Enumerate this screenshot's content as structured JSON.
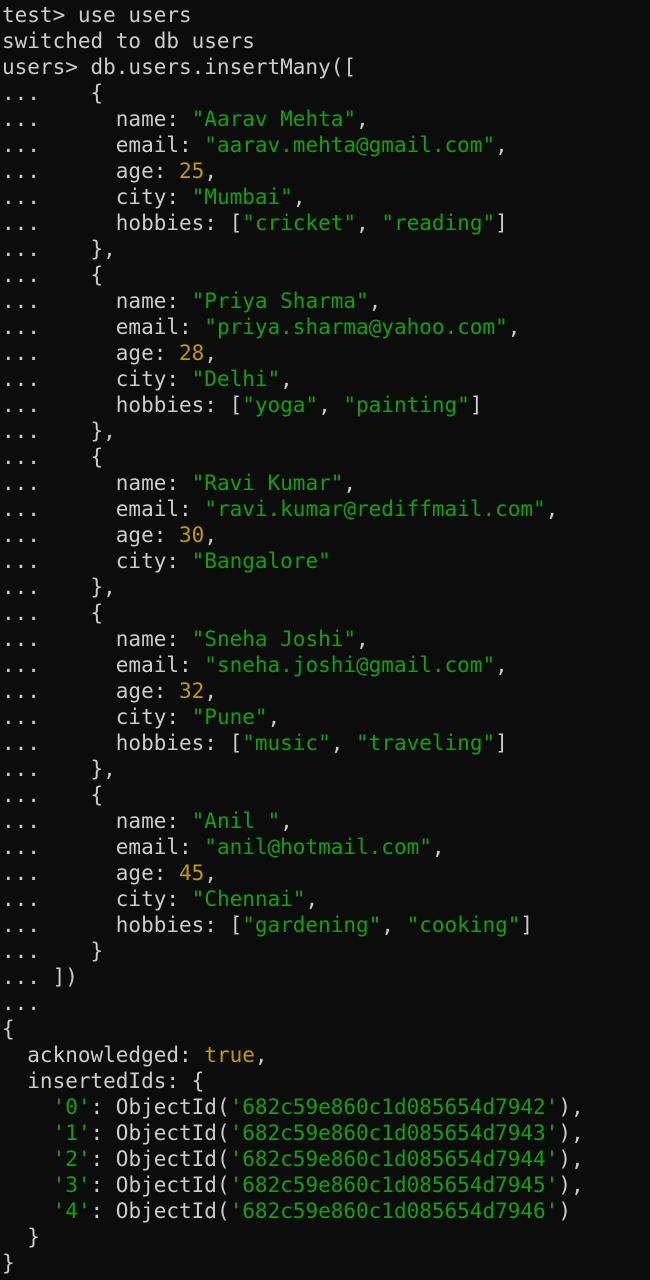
{
  "terminal": {
    "lines": [
      [
        {
          "t": "plain",
          "v": "test> use users"
        }
      ],
      [
        {
          "t": "plain",
          "v": "switched to db users"
        }
      ],
      [
        {
          "t": "plain",
          "v": "users> db.users.insertMany(["
        }
      ],
      [
        {
          "t": "plain",
          "v": "...    {"
        }
      ],
      [
        {
          "t": "plain",
          "v": "...      name: "
        },
        {
          "t": "str",
          "v": "\"Aarav Mehta\""
        },
        {
          "t": "plain",
          "v": ","
        }
      ],
      [
        {
          "t": "plain",
          "v": "...      email: "
        },
        {
          "t": "str",
          "v": "\"aarav.mehta@gmail.com\""
        },
        {
          "t": "plain",
          "v": ","
        }
      ],
      [
        {
          "t": "plain",
          "v": "...      age: "
        },
        {
          "t": "num",
          "v": "25"
        },
        {
          "t": "plain",
          "v": ","
        }
      ],
      [
        {
          "t": "plain",
          "v": "...      city: "
        },
        {
          "t": "str",
          "v": "\"Mumbai\""
        },
        {
          "t": "plain",
          "v": ","
        }
      ],
      [
        {
          "t": "plain",
          "v": "...      hobbies: ["
        },
        {
          "t": "str",
          "v": "\"cricket\""
        },
        {
          "t": "plain",
          "v": ", "
        },
        {
          "t": "str",
          "v": "\"reading\""
        },
        {
          "t": "plain",
          "v": "]"
        }
      ],
      [
        {
          "t": "plain",
          "v": "...    },"
        }
      ],
      [
        {
          "t": "plain",
          "v": "...    {"
        }
      ],
      [
        {
          "t": "plain",
          "v": "...      name: "
        },
        {
          "t": "str",
          "v": "\"Priya Sharma\""
        },
        {
          "t": "plain",
          "v": ","
        }
      ],
      [
        {
          "t": "plain",
          "v": "...      email: "
        },
        {
          "t": "str",
          "v": "\"priya.sharma@yahoo.com\""
        },
        {
          "t": "plain",
          "v": ","
        }
      ],
      [
        {
          "t": "plain",
          "v": "...      age: "
        },
        {
          "t": "num",
          "v": "28"
        },
        {
          "t": "plain",
          "v": ","
        }
      ],
      [
        {
          "t": "plain",
          "v": "...      city: "
        },
        {
          "t": "str",
          "v": "\"Delhi\""
        },
        {
          "t": "plain",
          "v": ","
        }
      ],
      [
        {
          "t": "plain",
          "v": "...      hobbies: ["
        },
        {
          "t": "str",
          "v": "\"yoga\""
        },
        {
          "t": "plain",
          "v": ", "
        },
        {
          "t": "str",
          "v": "\"painting\""
        },
        {
          "t": "plain",
          "v": "]"
        }
      ],
      [
        {
          "t": "plain",
          "v": "...    },"
        }
      ],
      [
        {
          "t": "plain",
          "v": "...    {"
        }
      ],
      [
        {
          "t": "plain",
          "v": "...      name: "
        },
        {
          "t": "str",
          "v": "\"Ravi Kumar\""
        },
        {
          "t": "plain",
          "v": ","
        }
      ],
      [
        {
          "t": "plain",
          "v": "...      email: "
        },
        {
          "t": "str",
          "v": "\"ravi.kumar@rediffmail.com\""
        },
        {
          "t": "plain",
          "v": ","
        }
      ],
      [
        {
          "t": "plain",
          "v": "...      age: "
        },
        {
          "t": "num",
          "v": "30"
        },
        {
          "t": "plain",
          "v": ","
        }
      ],
      [
        {
          "t": "plain",
          "v": "...      city: "
        },
        {
          "t": "str",
          "v": "\"Bangalore\""
        }
      ],
      [
        {
          "t": "plain",
          "v": "...    },"
        }
      ],
      [
        {
          "t": "plain",
          "v": "...    {"
        }
      ],
      [
        {
          "t": "plain",
          "v": "...      name: "
        },
        {
          "t": "str",
          "v": "\"Sneha Joshi\""
        },
        {
          "t": "plain",
          "v": ","
        }
      ],
      [
        {
          "t": "plain",
          "v": "...      email: "
        },
        {
          "t": "str",
          "v": "\"sneha.joshi@gmail.com\""
        },
        {
          "t": "plain",
          "v": ","
        }
      ],
      [
        {
          "t": "plain",
          "v": "...      age: "
        },
        {
          "t": "num",
          "v": "32"
        },
        {
          "t": "plain",
          "v": ","
        }
      ],
      [
        {
          "t": "plain",
          "v": "...      city: "
        },
        {
          "t": "str",
          "v": "\"Pune\""
        },
        {
          "t": "plain",
          "v": ","
        }
      ],
      [
        {
          "t": "plain",
          "v": "...      hobbies: ["
        },
        {
          "t": "str",
          "v": "\"music\""
        },
        {
          "t": "plain",
          "v": ", "
        },
        {
          "t": "str",
          "v": "\"traveling\""
        },
        {
          "t": "plain",
          "v": "]"
        }
      ],
      [
        {
          "t": "plain",
          "v": "...    },"
        }
      ],
      [
        {
          "t": "plain",
          "v": "...    {"
        }
      ],
      [
        {
          "t": "plain",
          "v": "...      name: "
        },
        {
          "t": "str",
          "v": "\"Anil \""
        },
        {
          "t": "plain",
          "v": ","
        }
      ],
      [
        {
          "t": "plain",
          "v": "...      email: "
        },
        {
          "t": "str",
          "v": "\"anil@hotmail.com\""
        },
        {
          "t": "plain",
          "v": ","
        }
      ],
      [
        {
          "t": "plain",
          "v": "...      age: "
        },
        {
          "t": "num",
          "v": "45"
        },
        {
          "t": "plain",
          "v": ","
        }
      ],
      [
        {
          "t": "plain",
          "v": "...      city: "
        },
        {
          "t": "str",
          "v": "\"Chennai\""
        },
        {
          "t": "plain",
          "v": ","
        }
      ],
      [
        {
          "t": "plain",
          "v": "...      hobbies: ["
        },
        {
          "t": "str",
          "v": "\"gardening\""
        },
        {
          "t": "plain",
          "v": ", "
        },
        {
          "t": "str",
          "v": "\"cooking\""
        },
        {
          "t": "plain",
          "v": "]"
        }
      ],
      [
        {
          "t": "plain",
          "v": "...    }"
        }
      ],
      [
        {
          "t": "plain",
          "v": "... ])"
        }
      ],
      [
        {
          "t": "plain",
          "v": "..."
        }
      ],
      [
        {
          "t": "plain",
          "v": "{"
        }
      ],
      [
        {
          "t": "plain",
          "v": "  acknowledged: "
        },
        {
          "t": "bool",
          "v": "true"
        },
        {
          "t": "plain",
          "v": ","
        }
      ],
      [
        {
          "t": "plain",
          "v": "  insertedIds: {"
        }
      ],
      [
        {
          "t": "plain",
          "v": "    "
        },
        {
          "t": "str",
          "v": "'0'"
        },
        {
          "t": "plain",
          "v": ": ObjectId("
        },
        {
          "t": "str",
          "v": "'682c59e860c1d085654d7942'"
        },
        {
          "t": "plain",
          "v": "),"
        }
      ],
      [
        {
          "t": "plain",
          "v": "    "
        },
        {
          "t": "str",
          "v": "'1'"
        },
        {
          "t": "plain",
          "v": ": ObjectId("
        },
        {
          "t": "str",
          "v": "'682c59e860c1d085654d7943'"
        },
        {
          "t": "plain",
          "v": "),"
        }
      ],
      [
        {
          "t": "plain",
          "v": "    "
        },
        {
          "t": "str",
          "v": "'2'"
        },
        {
          "t": "plain",
          "v": ": ObjectId("
        },
        {
          "t": "str",
          "v": "'682c59e860c1d085654d7944'"
        },
        {
          "t": "plain",
          "v": "),"
        }
      ],
      [
        {
          "t": "plain",
          "v": "    "
        },
        {
          "t": "str",
          "v": "'3'"
        },
        {
          "t": "plain",
          "v": ": ObjectId("
        },
        {
          "t": "str",
          "v": "'682c59e860c1d085654d7945'"
        },
        {
          "t": "plain",
          "v": "),"
        }
      ],
      [
        {
          "t": "plain",
          "v": "    "
        },
        {
          "t": "str",
          "v": "'4'"
        },
        {
          "t": "plain",
          "v": ": ObjectId("
        },
        {
          "t": "str",
          "v": "'682c59e860c1d085654d7946'"
        },
        {
          "t": "plain",
          "v": ")"
        }
      ],
      [
        {
          "t": "plain",
          "v": "  }"
        }
      ],
      [
        {
          "t": "plain",
          "v": "}"
        }
      ]
    ]
  }
}
